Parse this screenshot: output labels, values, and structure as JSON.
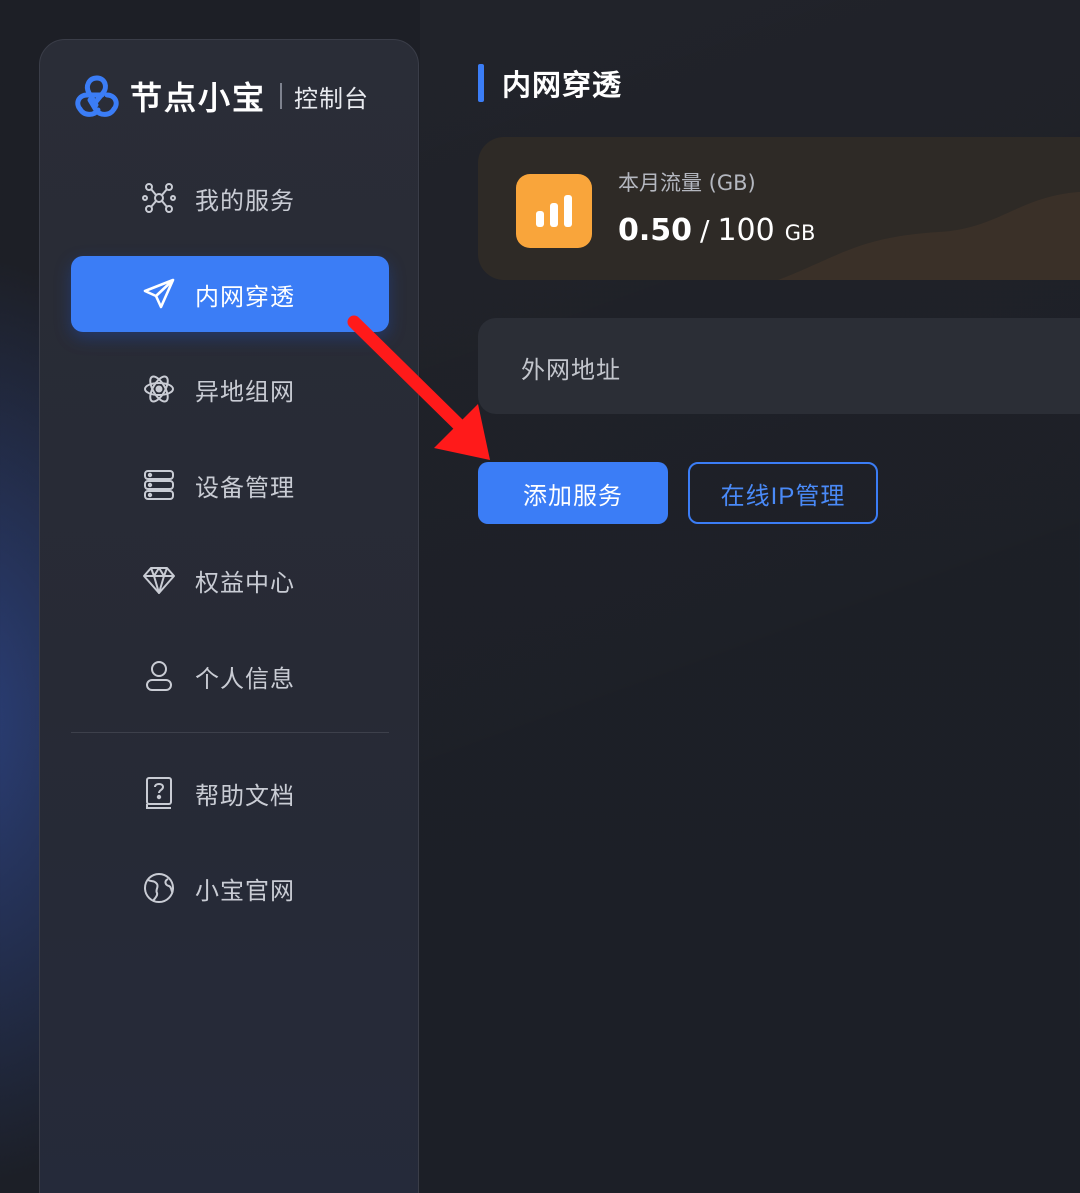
{
  "brand": {
    "name": "节点小宝",
    "subtitle": "控制台",
    "logo_icon": "tri-loop-logo-icon",
    "accent_color": "#3b7df6"
  },
  "sidebar": {
    "items": [
      {
        "label": "我的服务",
        "icon": "network-nodes-icon",
        "active": false
      },
      {
        "label": "内网穿透",
        "icon": "paper-plane-icon",
        "active": true
      },
      {
        "label": "异地组网",
        "icon": "atom-orbit-icon",
        "active": false
      },
      {
        "label": "设备管理",
        "icon": "server-stack-icon",
        "active": false
      },
      {
        "label": "权益中心",
        "icon": "diamond-icon",
        "active": false
      },
      {
        "label": "个人信息",
        "icon": "user-icon",
        "active": false
      }
    ],
    "footer_items": [
      {
        "label": "帮助文档",
        "icon": "help-book-icon"
      },
      {
        "label": "小宝官网",
        "icon": "globe-icon"
      }
    ]
  },
  "main": {
    "page_title": "内网穿透",
    "traffic": {
      "label": "本月流量 (GB)",
      "used": "0.50",
      "separator": "/",
      "total": "100",
      "unit": "GB",
      "icon": "bar-chart-icon",
      "icon_color": "#f9a53b"
    },
    "address": {
      "label": "外网地址"
    },
    "buttons": {
      "add_service": "添加服务",
      "ip_manage": "在线IP管理"
    }
  },
  "annotation": {
    "arrow_color": "#ff1a1a",
    "arrow_icon": "red-pointer-arrow-icon"
  }
}
